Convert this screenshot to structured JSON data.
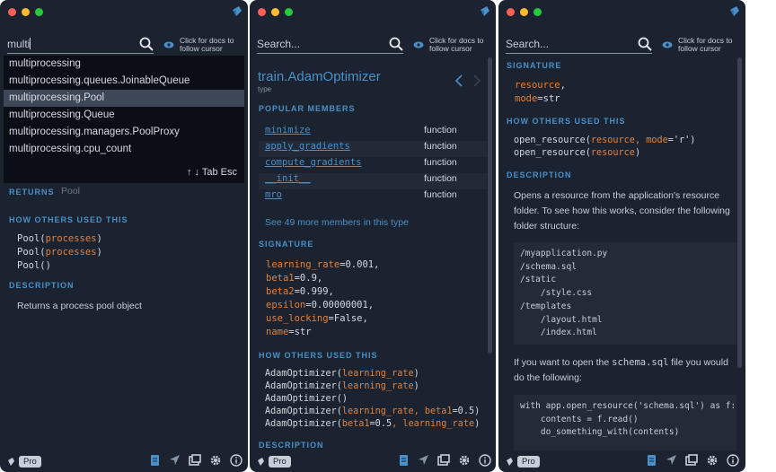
{
  "colors": {
    "panel_bg": "#1b2330",
    "accent_blue": "#4a90c9",
    "accent_orange": "#e5813b",
    "dropdown_bg": "#0b0e14",
    "selected_bg": "#3e4757"
  },
  "common": {
    "follow_label": "Click for docs to follow cursor",
    "pro_label": "Pro",
    "search_placeholder": "Search..."
  },
  "panel1": {
    "search_value": "multi",
    "suggestions": [
      "multiprocessing",
      "multiprocessing.queues.JoinableQueue",
      "multiprocessing.Pool",
      "multiprocessing.Queue",
      "multiprocessing.managers.PoolProxy",
      "multiprocessing.cpu_count"
    ],
    "selected_index": 2,
    "hint": "↑ ↓ Tab Esc",
    "returns_title": "RETURNS",
    "returns_value": "Pool",
    "usage_title": "HOW OTHERS USED THIS",
    "usage": [
      {
        "fn": "Pool(",
        "arg": "processes",
        "end": ")"
      },
      {
        "fn": "Pool(",
        "arg": "processes",
        "end": ")"
      },
      {
        "fn": "Pool(",
        "arg": "",
        "end": ")"
      }
    ],
    "description_title": "DESCRIPTION",
    "description": "Returns a process pool object"
  },
  "panel2": {
    "title": "train.AdamOptimizer",
    "kind": "type",
    "members_title": "POPULAR MEMBERS",
    "members": [
      {
        "name": "minimize",
        "kind": "function"
      },
      {
        "name": "apply_gradients",
        "kind": "function"
      },
      {
        "name": "compute_gradients",
        "kind": "function"
      },
      {
        "name": "__init__",
        "kind": "function"
      },
      {
        "name": "mro",
        "kind": "function"
      }
    ],
    "more_link": "See 49 more members in this type",
    "signature_title": "SIGNATURE",
    "signature": [
      {
        "param": "learning_rate",
        "val": "=0.001,"
      },
      {
        "param": "beta1",
        "val": "=0.9,"
      },
      {
        "param": "beta2",
        "val": "=0.999,"
      },
      {
        "param": "epsilon",
        "val": "=0.00000001,"
      },
      {
        "param": "use_locking",
        "val": "=False,"
      },
      {
        "param": "name",
        "val": "=str"
      }
    ],
    "usage_title": "HOW OTHERS USED THIS",
    "usage": [
      {
        "fn": "AdamOptimizer(",
        "args": "learning_rate",
        "end": ")"
      },
      {
        "fn": "AdamOptimizer(",
        "args": "learning_rate",
        "end": ")"
      },
      {
        "fn": "AdamOptimizer(",
        "args": "",
        "end": ")"
      },
      {
        "fn": "AdamOptimizer(",
        "args": "learning_rate, beta1",
        "val": "=0.5",
        "end": ")"
      },
      {
        "fn": "AdamOptimizer(",
        "args": "beta1",
        "val": "=0.5",
        "args2": ", learning_rate",
        "end": ")"
      }
    ],
    "description_title": "DESCRIPTION"
  },
  "panel3": {
    "signature_title": "SIGNATURE",
    "signature": [
      {
        "param": "resource",
        "val": ","
      },
      {
        "param": "mode",
        "val": "=str"
      }
    ],
    "usage_title": "HOW OTHERS USED THIS",
    "usage": [
      {
        "fn": "open_resource(",
        "args": "resource, mode",
        "val": "='r'",
        "end": ")"
      },
      {
        "fn": "open_resource(",
        "args": "resource",
        "end": ")"
      }
    ],
    "description_title": "DESCRIPTION",
    "description_1": "Opens a resource from the application's resource folder. To see how this works, consider the following folder structure:",
    "folder_tree": "/myapplication.py\n/schema.sql\n/static\n    /style.css\n/templates\n    /layout.html\n    /index.html",
    "description_2_pre": "If you want to open the ",
    "description_2_code": "schema.sql",
    "description_2_post": " file you would do the following:",
    "code_example": "with app.open_resource('schema.sql') as f:\n    contents = f.read()\n    do_something_with(contents)"
  },
  "icons": [
    "kite-logo-icon",
    "search-icon",
    "eye-icon",
    "back-arrow-icon",
    "forward-arrow-icon",
    "document-icon",
    "navigate-icon",
    "window-icon",
    "settings-icon",
    "info-icon"
  ]
}
